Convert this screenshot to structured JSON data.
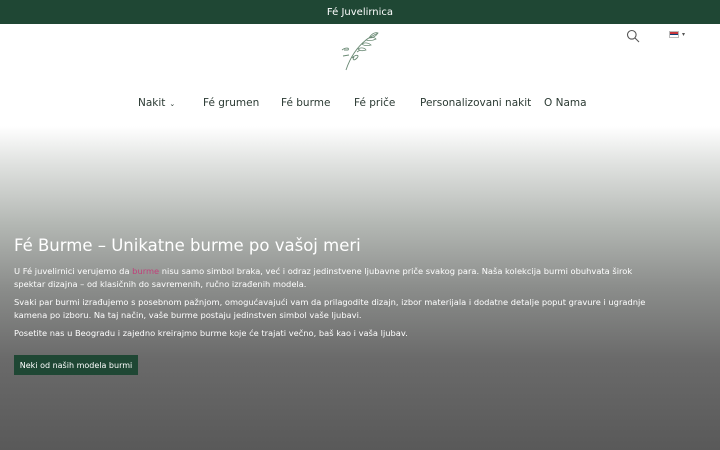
{
  "topbar": {
    "text": "Fé Juvelirnica"
  },
  "header": {
    "logo_icon": "fe-leaf-logo",
    "search_icon": "search-icon",
    "language": {
      "flag": "serbia-flag-icon",
      "colors": [
        "#c6363c",
        "#0c4076",
        "#ffffff"
      ]
    }
  },
  "nav": {
    "items": [
      {
        "label": "Nakit",
        "has_dropdown": true
      },
      {
        "label": "Fé grumen"
      },
      {
        "label": "Fé burme"
      },
      {
        "label": "Fé priče"
      },
      {
        "label": "Personalizovani nakit"
      },
      {
        "label": "O Nama"
      }
    ]
  },
  "hero": {
    "title": "Fé Burme – Unikatne burme po vašoj meri",
    "p1_before": "U Fé juvelirnici verujemo da ",
    "p1_link": "burme",
    "p1_after": " nisu samo simbol braka, već i odraz jedinstvene ljubavne priče svakog para. Naša kolekcija burmi obuhvata širok spektar dizajna – od klasičnih do savremenih, ručno izrađenih modela.",
    "p2": "Svaki par burmi izrađujemo s posebnom pažnjom, omogućavajući vam da prilagodite dizajn, izbor materijala i dodatne detalje poput gravure i ugradnje kamena po izboru. Na taj način, vaše burme postaju jedinstven simbol vaše ljubavi.",
    "p3": "Posetite nas u Beogradu i zajedno kreirajmo burme koje će trajati večno, baš kao i vaša ljubav.",
    "cta": "Neki od naših modela burmi"
  },
  "colors": {
    "brand_green": "#1f4734",
    "link_pink": "#c0407a"
  }
}
